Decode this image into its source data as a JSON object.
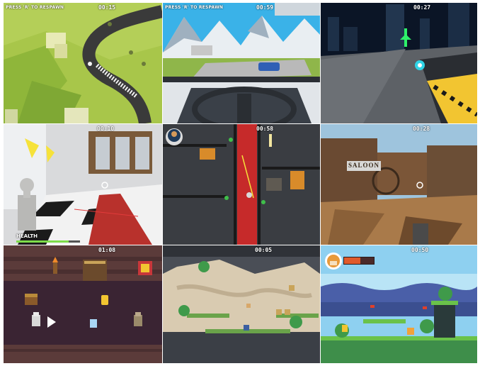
{
  "tiles": [
    {
      "name": "low-poly-racing-aerial",
      "timer": "00:15",
      "respawn_hint": "PRESS 'R' TO RESPAWN"
    },
    {
      "name": "car-cockpit-mountains",
      "timer": "00:59",
      "respawn_hint": "PRESS 'R' TO RESPAWN"
    },
    {
      "name": "futuristic-city-racer",
      "timer": "00:27"
    },
    {
      "name": "museum-fps",
      "timer": "00:10",
      "health_label": "HEALTH",
      "health": 0.82
    },
    {
      "name": "top-down-shooter",
      "timer": "00:58"
    },
    {
      "name": "western-saloon-fps",
      "timer": "00:28",
      "sign_text": "SALOON"
    },
    {
      "name": "pixel-dungeon",
      "timer": "01:08"
    },
    {
      "name": "pixel-platformer-cave",
      "timer": "00:05"
    },
    {
      "name": "pixel-platformer-shiba",
      "timer": "00:50",
      "health": 0.55
    }
  ],
  "colors": {
    "hud_text": "#ffffff",
    "health_bar": "#e05a2b",
    "health_green": "#7ddc4a"
  }
}
